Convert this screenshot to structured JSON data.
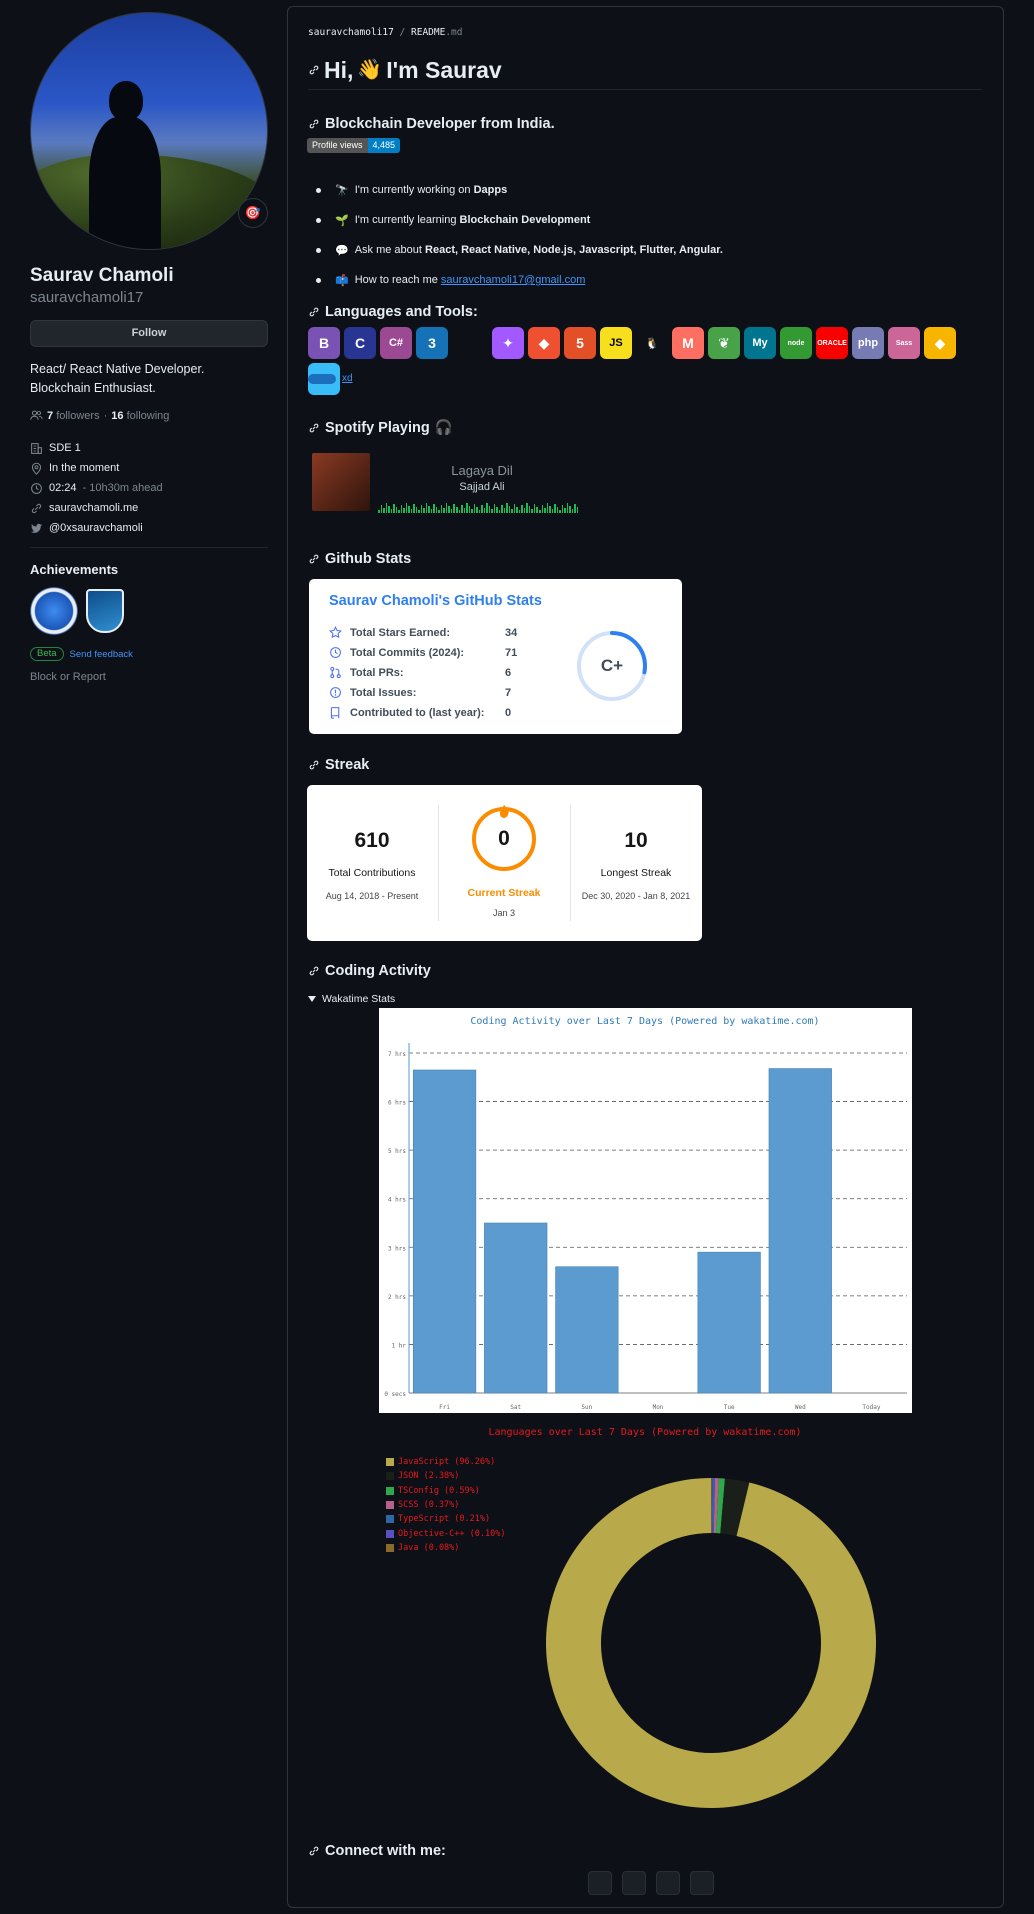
{
  "profile": {
    "name": "Saurav Chamoli",
    "login": "sauravchamoli17",
    "status_emoji": "🎯",
    "follow_label": "Follow",
    "bio": "React/ React Native Developer.\nBlockchain Enthusiast.",
    "followers_count": "7",
    "followers_label": "followers",
    "following_count": "16",
    "following_label": "following",
    "dot": "·",
    "company": "SDE 1",
    "location": "In the moment",
    "local_time": "02:24",
    "time_ahead": "- 10h30m ahead",
    "website": "sauravchamoli.me",
    "twitter": "@0xsauravchamoli",
    "achievements_title": "Achievements",
    "beta_label": "Beta",
    "feedback_label": "Send feedback",
    "block_label": "Block or Report"
  },
  "readme": {
    "breadcrumb_user": "sauravchamoli17",
    "breadcrumb_sep": "/",
    "breadcrumb_file": "README",
    "breadcrumb_ext": ".md",
    "title_hi": "Hi,",
    "title_wave": "👋",
    "title_rest": "I'm Saurav",
    "subtitle": "Blockchain Developer from India.",
    "profile_views_label": "Profile views",
    "profile_views_value": "4,485",
    "bullets": [
      {
        "emoji": "🔭",
        "text": "I'm currently working on ",
        "bold": "Dapps"
      },
      {
        "emoji": "🌱",
        "text": "I'm currently learning ",
        "bold": "Blockchain Development"
      },
      {
        "emoji": "💬",
        "text": "Ask me about ",
        "bold": "React, React Native, Node.js, Javascript, Flutter, Angular."
      },
      {
        "emoji": "📫",
        "text": "How to reach me ",
        "link": "sauravchamoli17@gmail.com"
      }
    ],
    "languages_heading": "Languages and Tools:",
    "tools": [
      {
        "icon": "bootstrap-icon",
        "glyph": "B",
        "color": "#7952b3"
      },
      {
        "icon": "c-icon",
        "glyph": "C",
        "color": "#283593"
      },
      {
        "icon": "csharp-icon",
        "glyph": "C#",
        "color": "#9b4993"
      },
      {
        "icon": "css3-icon",
        "glyph": "3",
        "color": "#1572b6"
      },
      {
        "icon": "figma-icon",
        "glyph": "✦",
        "color": "#a259ff"
      },
      {
        "icon": "git-icon",
        "glyph": "◆",
        "color": "#f05032"
      },
      {
        "icon": "html5-icon",
        "glyph": "5",
        "color": "#e34f26"
      },
      {
        "icon": "javascript-icon",
        "glyph": "JS",
        "color": "#f7df1e"
      },
      {
        "icon": "linux-icon",
        "glyph": "🐧",
        "color": "#0d1117"
      },
      {
        "icon": "mithril-icon",
        "glyph": "M",
        "color": "#ff6f61"
      },
      {
        "icon": "mongodb-icon",
        "glyph": "❦",
        "color": "#47a248"
      },
      {
        "icon": "mysql-icon",
        "glyph": "My",
        "color": "#00758f"
      },
      {
        "icon": "nodejs-icon",
        "glyph": "node",
        "color": "#339933"
      },
      {
        "icon": "oracle-icon",
        "glyph": "ORACLE",
        "color": "#f80000"
      },
      {
        "icon": "php-icon",
        "glyph": "php",
        "color": "#777bb4"
      },
      {
        "icon": "sass-icon",
        "glyph": "Sass",
        "color": "#cc6699"
      },
      {
        "icon": "sketch-icon",
        "glyph": "◆",
        "color": "#f7b500"
      },
      {
        "icon": "tailwind-icon",
        "glyph": "≈",
        "color": "#38bdf8"
      }
    ],
    "xd_alt": "xd",
    "spotify_heading": "Spotify Playing",
    "spotify_emoji": "🎧",
    "song": "Lagaya Dil",
    "artist": "Sajjad Ali",
    "github_stats_heading": "Github Stats",
    "streak_heading": "Streak",
    "coding_heading": "Coding Activity",
    "wakatime_summary": "Wakatime Stats",
    "connect_heading": "Connect with me:"
  },
  "github_stats": {
    "title": "Saurav Chamoli's GitHub Stats",
    "grade": "C+",
    "grade_progress": 0.28,
    "rows": [
      {
        "icon": "star-icon",
        "label": "Total Stars Earned:",
        "value": "34"
      },
      {
        "icon": "history-icon",
        "label": "Total Commits (2024):",
        "value": "71"
      },
      {
        "icon": "pull-request-icon",
        "label": "Total PRs:",
        "value": "6"
      },
      {
        "icon": "issue-icon",
        "label": "Total Issues:",
        "value": "7"
      },
      {
        "icon": "repo-icon",
        "label": "Contributed to (last year):",
        "value": "0"
      }
    ]
  },
  "streak": {
    "total": "610",
    "total_label": "Total Contributions",
    "total_range": "Aug 14, 2018 - Present",
    "current": "0",
    "current_label": "Current Streak",
    "current_date": "Jan 3",
    "longest": "10",
    "longest_label": "Longest Streak",
    "longest_range": "Dec 30, 2020 - Jan 8, 2021"
  },
  "chart_data": [
    {
      "type": "bar",
      "title": "Coding Activity over Last 7 Days (Powered by wakatime.com)",
      "categories": [
        "Fri",
        "Sat",
        "Sun",
        "Mon",
        "Tue",
        "Wed",
        "Today"
      ],
      "values": [
        6.65,
        3.5,
        2.6,
        0,
        2.9,
        6.68,
        0
      ],
      "ylim": [
        0,
        7
      ],
      "y_ticks": [
        "0 secs",
        "1 hr",
        "2 hrs",
        "3 hrs",
        "4 hrs",
        "5 hrs",
        "6 hrs",
        "7 hrs"
      ],
      "grid": true,
      "color": "#5b9bcf"
    },
    {
      "type": "pie",
      "title": "Languages over Last 7 Days (Powered by wakatime.com)",
      "legend_position": "top-left",
      "series": [
        {
          "name": "JavaScript",
          "label": "JavaScript (96.26%)",
          "value": 96.26,
          "color": "#b8a94a"
        },
        {
          "name": "JSON",
          "label": "JSON (2.38%)",
          "value": 2.38,
          "color": "#1a1f1a"
        },
        {
          "name": "TSConfig",
          "label": "TSConfig (0.59%)",
          "value": 0.59,
          "color": "#2fa84b"
        },
        {
          "name": "SCSS",
          "label": "SCSS (0.37%)",
          "value": 0.37,
          "color": "#b5618a"
        },
        {
          "name": "TypeScript",
          "label": "TypeScript (0.21%)",
          "value": 0.21,
          "color": "#2f66a6"
        },
        {
          "name": "Objective-C++",
          "label": "Objective-C++ (0.10%)",
          "value": 0.1,
          "color": "#5a4fc1"
        },
        {
          "name": "Java",
          "label": "Java (0.08%)",
          "value": 0.08,
          "color": "#8a6a2a"
        }
      ]
    }
  ]
}
